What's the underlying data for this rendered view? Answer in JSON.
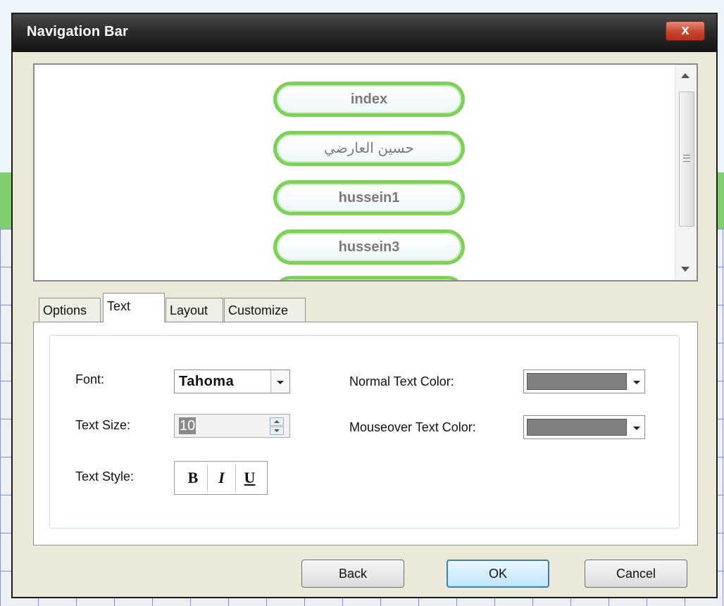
{
  "window": {
    "title": "Navigation Bar",
    "close_label": "x"
  },
  "preview": {
    "buttons": [
      "index",
      "حسين العارضي",
      "hussein1",
      "hussein3"
    ],
    "colors": {
      "button_border": "#7fd05a",
      "button_text": "#7a7a7a"
    }
  },
  "tabs": [
    {
      "label": "Options",
      "active": false
    },
    {
      "label": "Text",
      "active": true
    },
    {
      "label": "Layout",
      "active": false
    },
    {
      "label": "Customize",
      "active": false
    }
  ],
  "text_tab": {
    "font_label": "Font:",
    "font_value": "Tahoma",
    "size_label": "Text Size:",
    "size_value": "10",
    "style_label": "Text Style:",
    "style_bold": "B",
    "style_italic": "I",
    "style_underline": "U",
    "normal_color_label": "Normal Text Color:",
    "normal_color": "#808080",
    "mouseover_color_label": "Mouseover Text Color:",
    "mouseover_color": "#808080"
  },
  "footer": {
    "back_label": "Back",
    "ok_label": "OK",
    "cancel_label": "Cancel"
  }
}
